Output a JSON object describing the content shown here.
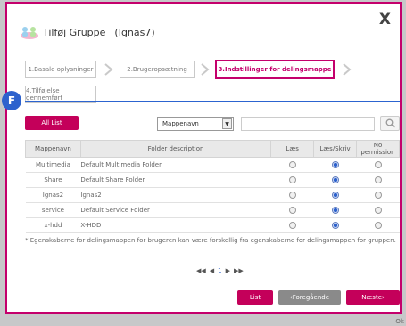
{
  "dialog": {
    "title": "Tilføj Gruppe",
    "group_name": "(Ignas7)",
    "close_label": "X"
  },
  "steps": [
    {
      "label": "1.Basale oplysninger",
      "active": false
    },
    {
      "label": "2.Brugeropsætning",
      "active": false
    },
    {
      "label": "3.Indstillinger for delingsmappe",
      "active": true
    },
    {
      "label": "4.Tilføjelse gennemført",
      "active": false
    }
  ],
  "badge": "F",
  "toolbar": {
    "all_list_label": "All List",
    "filter_value": "Mappenavn",
    "search_value": ""
  },
  "table": {
    "headers": [
      "Mappenavn",
      "Folder description",
      "Læs",
      "Læs/Skriv",
      "No permission"
    ],
    "rows": [
      {
        "name": "Multimedia",
        "description": "Default Multimedia Folder",
        "permission": "read_write"
      },
      {
        "name": "Share",
        "description": "Default Share Folder",
        "permission": "read_write"
      },
      {
        "name": "Ignas2",
        "description": "Ignas2",
        "permission": "read_write"
      },
      {
        "name": "service",
        "description": "Default Service Folder",
        "permission": "read_write"
      },
      {
        "name": "x-hdd",
        "description": "X-HDD",
        "permission": "read_write"
      }
    ]
  },
  "note": "* Egenskaberne for delingsmappen for brugeren kan være forskellig fra egenskaberne for delingsmappen for gruppen.",
  "pagination": {
    "current_page": "1"
  },
  "buttons": {
    "list": "List",
    "previous": "‹Foregående",
    "next": "Næste›"
  },
  "corner_text": "Ok",
  "colors": {
    "accent": "#c4006c",
    "badge": "#2d62cd",
    "selected_radio": "#2d62cd"
  }
}
